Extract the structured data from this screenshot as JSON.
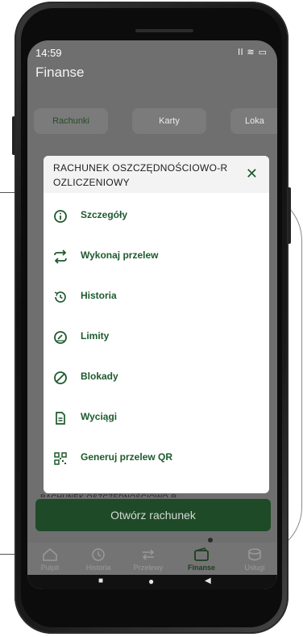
{
  "status_bar": {
    "time": "14:59",
    "icons": "ll ≋ ▭"
  },
  "app": {
    "title": "Finanse",
    "tabs": [
      {
        "label": "Rachunki",
        "active": true
      },
      {
        "label": "Karty",
        "active": false
      },
      {
        "label": "Loka",
        "active": false
      }
    ],
    "behind_text": "RACHUNEK OSZCZĘDNOŚCIOWO-R",
    "open_button": "Otwórz rachunek"
  },
  "modal": {
    "title": "RACHUNEK OSZCZĘDNOŚCIOWO-R OZLICZENIOWY",
    "close_icon": "close-icon",
    "items": [
      {
        "label": "Szczegóły",
        "icon": "info-icon"
      },
      {
        "label": "Wykonaj przelew",
        "icon": "transfer-arrows-icon"
      },
      {
        "label": "Historia",
        "icon": "history-icon"
      },
      {
        "label": "Limity",
        "icon": "gauge-icon"
      },
      {
        "label": "Blokady",
        "icon": "block-icon"
      },
      {
        "label": "Wyciągi",
        "icon": "document-icon"
      },
      {
        "label": "Generuj przelew QR",
        "icon": "qr-code-icon"
      }
    ]
  },
  "bottom_nav": [
    {
      "label": "Pulpit",
      "icon": "home-icon"
    },
    {
      "label": "Historia",
      "icon": "history-icon"
    },
    {
      "label": "Przelewy",
      "icon": "transfer-icon"
    },
    {
      "label": "Finanse",
      "icon": "wallet-icon",
      "active": true
    },
    {
      "label": "Usługi",
      "icon": "services-icon"
    }
  ],
  "colors": {
    "accent": "#1d5a2c",
    "open_button": "#1e4a27"
  }
}
